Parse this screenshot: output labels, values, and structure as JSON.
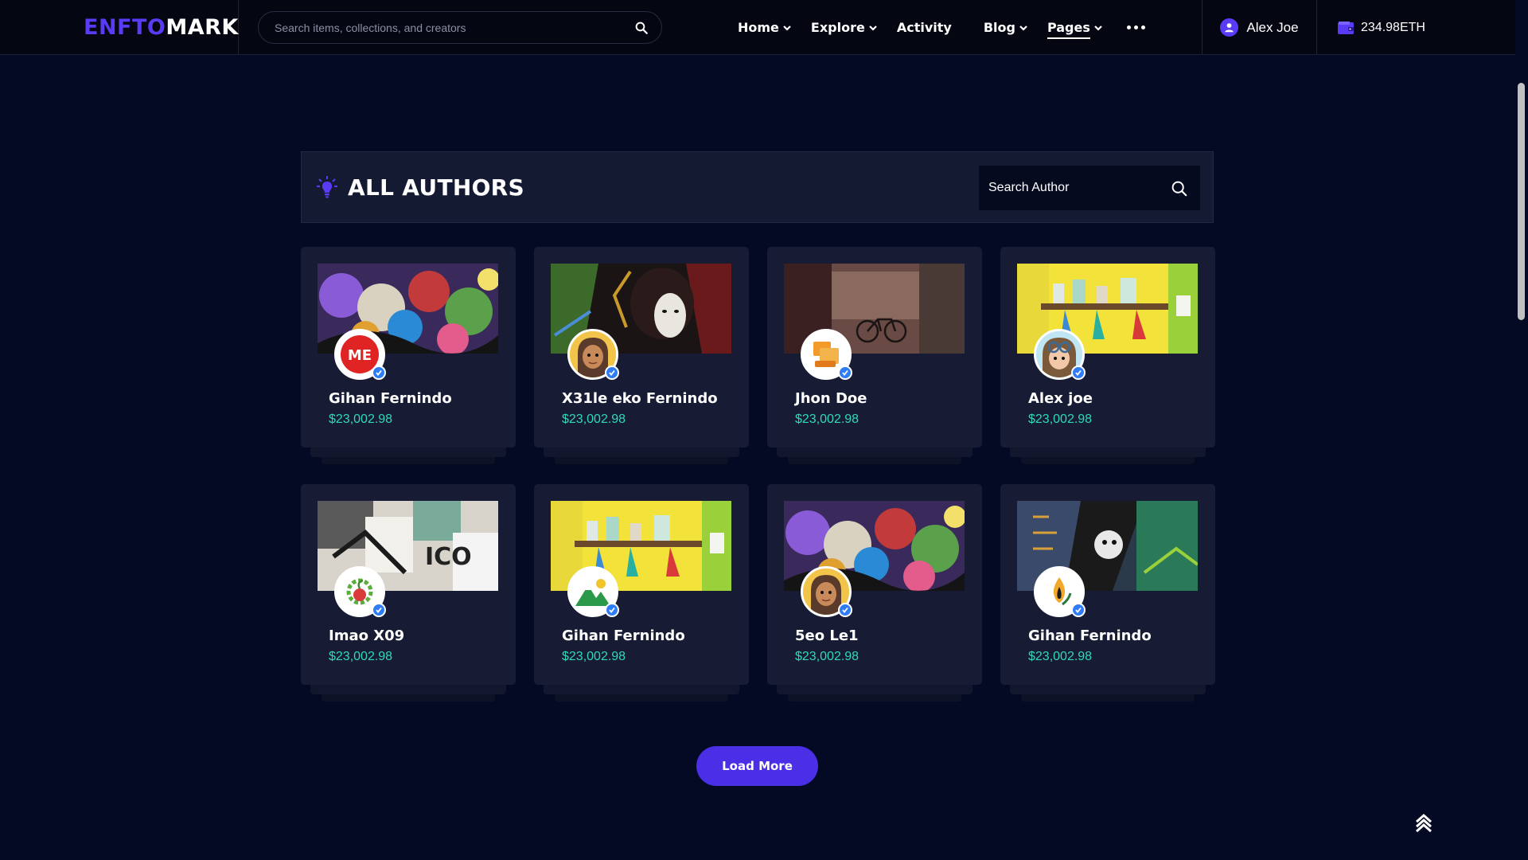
{
  "header": {
    "logo_accent": "ENFTO",
    "logo_rest": "MARK",
    "search_placeholder": "Search items, collections, and creators",
    "nav": [
      {
        "label": "Home",
        "dropdown": true
      },
      {
        "label": "Explore",
        "dropdown": true
      },
      {
        "label": "Activity",
        "dropdown": false
      },
      {
        "label": "Blog",
        "dropdown": true
      },
      {
        "label": "Pages",
        "dropdown": true,
        "active": true
      }
    ],
    "user_name": "Alex Joe",
    "wallet_balance": "234.98ETH"
  },
  "authors_panel": {
    "title": "ALL AUTHORS",
    "search_placeholder": "Search Author"
  },
  "authors": [
    {
      "name": "Gihan Fernindo",
      "price": "$23,002.98",
      "cover": "graffiti",
      "avatar": "me-logo"
    },
    {
      "name": "X31le eko Fernindo",
      "price": "$23,002.98",
      "cover": "geisha-mural",
      "avatar": "cartoon-girl"
    },
    {
      "name": "Jhon Doe",
      "price": "$23,002.98",
      "cover": "bicycle-wall",
      "avatar": "orange-squares"
    },
    {
      "name": "Alex joe",
      "price": "$23,002.98",
      "cover": "yellow-shelf",
      "avatar": "aviator-girl"
    },
    {
      "name": "Imao X09",
      "price": "$23,002.98",
      "cover": "collage-posters",
      "avatar": "green-plant-logo"
    },
    {
      "name": "Gihan Fernindo",
      "price": "$23,002.98",
      "cover": "yellow-shelf",
      "avatar": "mountain-sun"
    },
    {
      "name": "5eo Le1",
      "price": "$23,002.98",
      "cover": "graffiti",
      "avatar": "cartoon-girl"
    },
    {
      "name": "Gihan Fernindo",
      "price": "$23,002.98",
      "cover": "robot-mural",
      "avatar": "flame-leaf"
    }
  ],
  "load_more_label": "Load More",
  "colors": {
    "background": "#050a24",
    "brand_purple": "#5a3bf5",
    "price_teal": "#2fd9b9",
    "verified_blue": "#2f7df6"
  }
}
